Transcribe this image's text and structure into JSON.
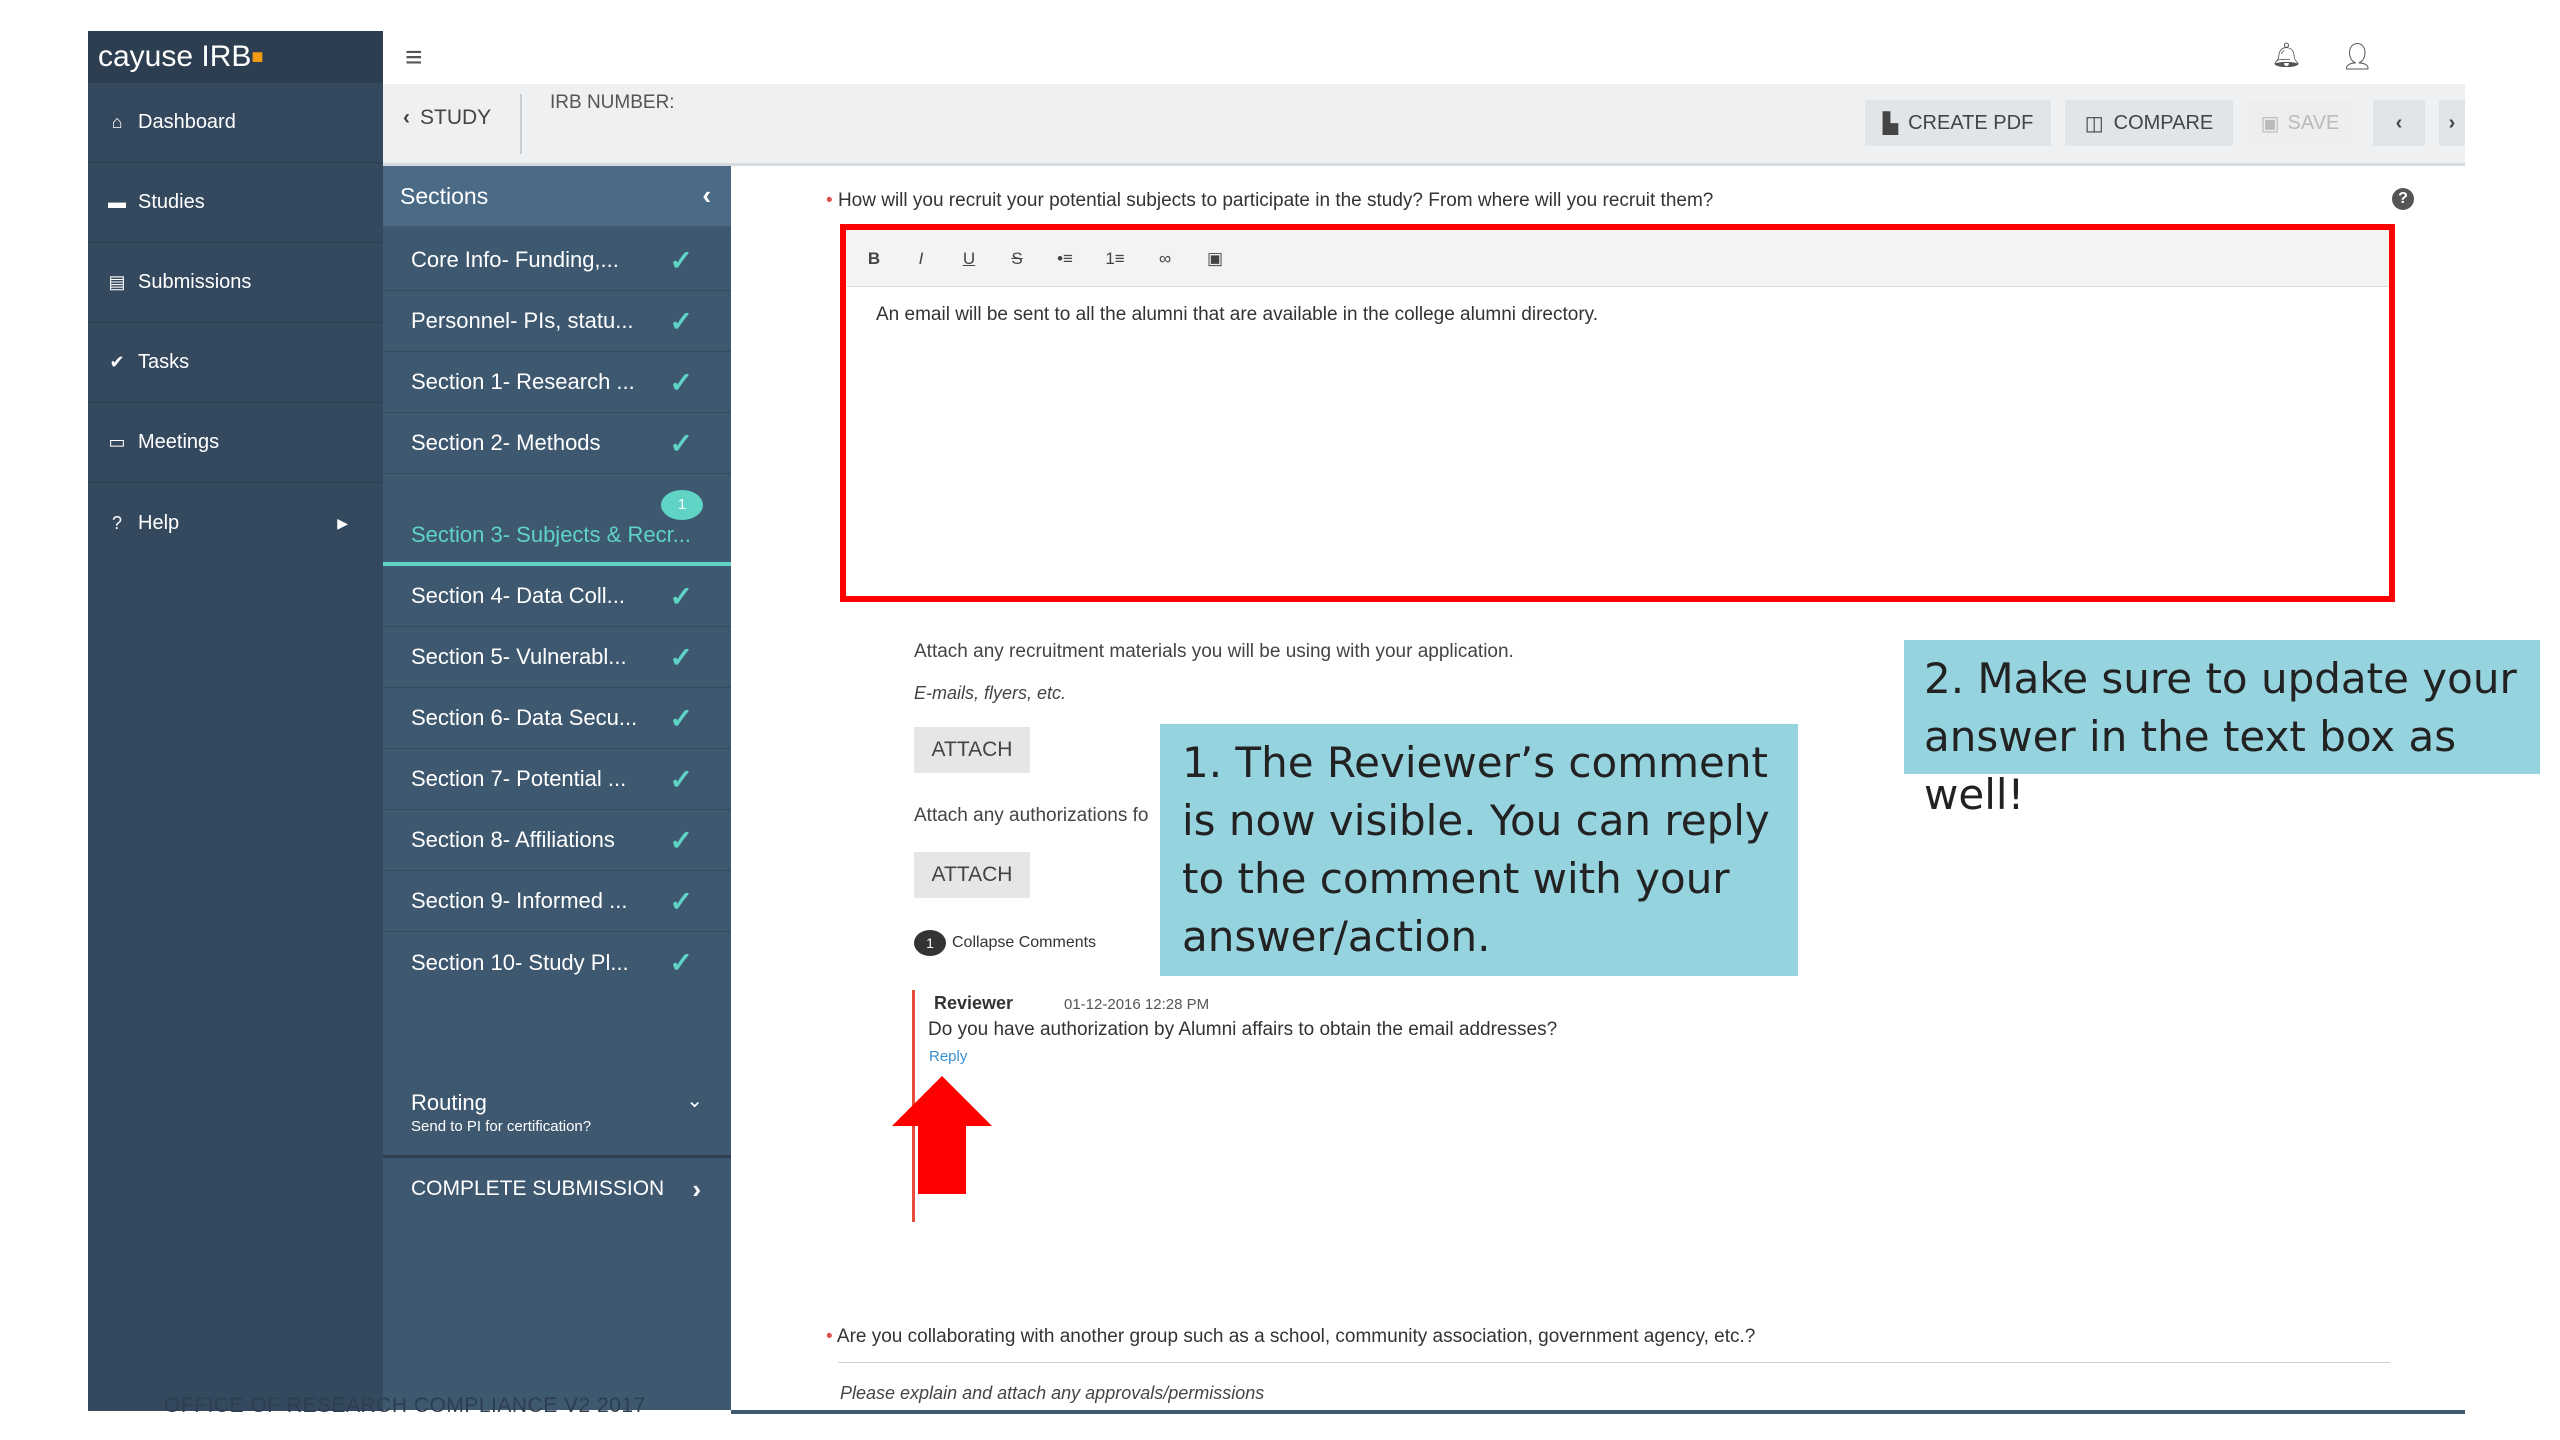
{
  "app": {
    "logo": "cayuse IRB"
  },
  "nav": [
    {
      "label": "Dashboard",
      "icon": "home-icon",
      "glyph": "⌂"
    },
    {
      "label": "Studies",
      "icon": "folder-icon",
      "glyph": "▬"
    },
    {
      "label": "Submissions",
      "icon": "file-icon",
      "glyph": "▤"
    },
    {
      "label": "Tasks",
      "icon": "check-icon",
      "glyph": "✔"
    },
    {
      "label": "Meetings",
      "icon": "calendar-icon",
      "glyph": "▭"
    },
    {
      "label": "Help",
      "icon": "question-icon",
      "glyph": "?"
    }
  ],
  "topbar": {
    "back_label": "STUDY",
    "irb_label": "IRB NUMBER:",
    "create_pdf": "CREATE PDF",
    "compare": "COMPARE",
    "save": "SAVE"
  },
  "sections": {
    "title": "Sections",
    "items": [
      "Core Info- Funding,...",
      "Personnel- PIs, statu...",
      "Section 1- Research ...",
      "Section 2- Methods",
      "Section 3- Subjects & Recr...",
      "Section 4- Data Coll...",
      "Section 5- Vulnerabl...",
      "Section 6- Data Secu...",
      "Section 7- Potential ...",
      "Section 8- Affiliations",
      "Section 9- Informed ...",
      "Section 10- Study Pl..."
    ],
    "comment_count": "1",
    "routing": "Routing",
    "routing_sub": "Send to PI for certification?",
    "complete": "COMPLETE SUBMISSION"
  },
  "question1": {
    "label": "How will you recruit your potential subjects to participate in the study? From where will you recruit them?",
    "answer": "An email will be sent to all the alumni that are available in the college alumni directory.",
    "toolbar": [
      "B",
      "I",
      "U",
      "S",
      "•≡",
      "1≡",
      "∞",
      "▣"
    ]
  },
  "attach1": {
    "label": "Attach any recruitment materials you will be using with your application.",
    "hint": "E-mails, flyers, etc.",
    "button": "ATTACH"
  },
  "attach2": {
    "label": "Attach any authorizations fo",
    "button": "ATTACH"
  },
  "comments": {
    "collapse": "Collapse Comments",
    "count": "1",
    "author": "Reviewer",
    "date": "01-12-2016 12:28 PM",
    "text": "Do you have authorization by Alumni affairs to obtain the email addresses?",
    "reply": "Reply"
  },
  "callout1": "1. The Reviewer’s comment is now visible. You can reply to the comment with your answer/action.",
  "callout2": "2. Make sure to update your answer in the text box as well!",
  "question2": {
    "label": "Are you collaborating with another group such as a school, community association, government agency, etc.?",
    "hint": "Please explain and attach any approvals/permissions"
  },
  "footer": "OFFICE OF RESEARCH COMPLIANCE V2 2017",
  "colors": {
    "accent": "#5fd3c4",
    "callout": "#95d3df",
    "highlight": "#ff0000",
    "nav": "#34495e"
  }
}
